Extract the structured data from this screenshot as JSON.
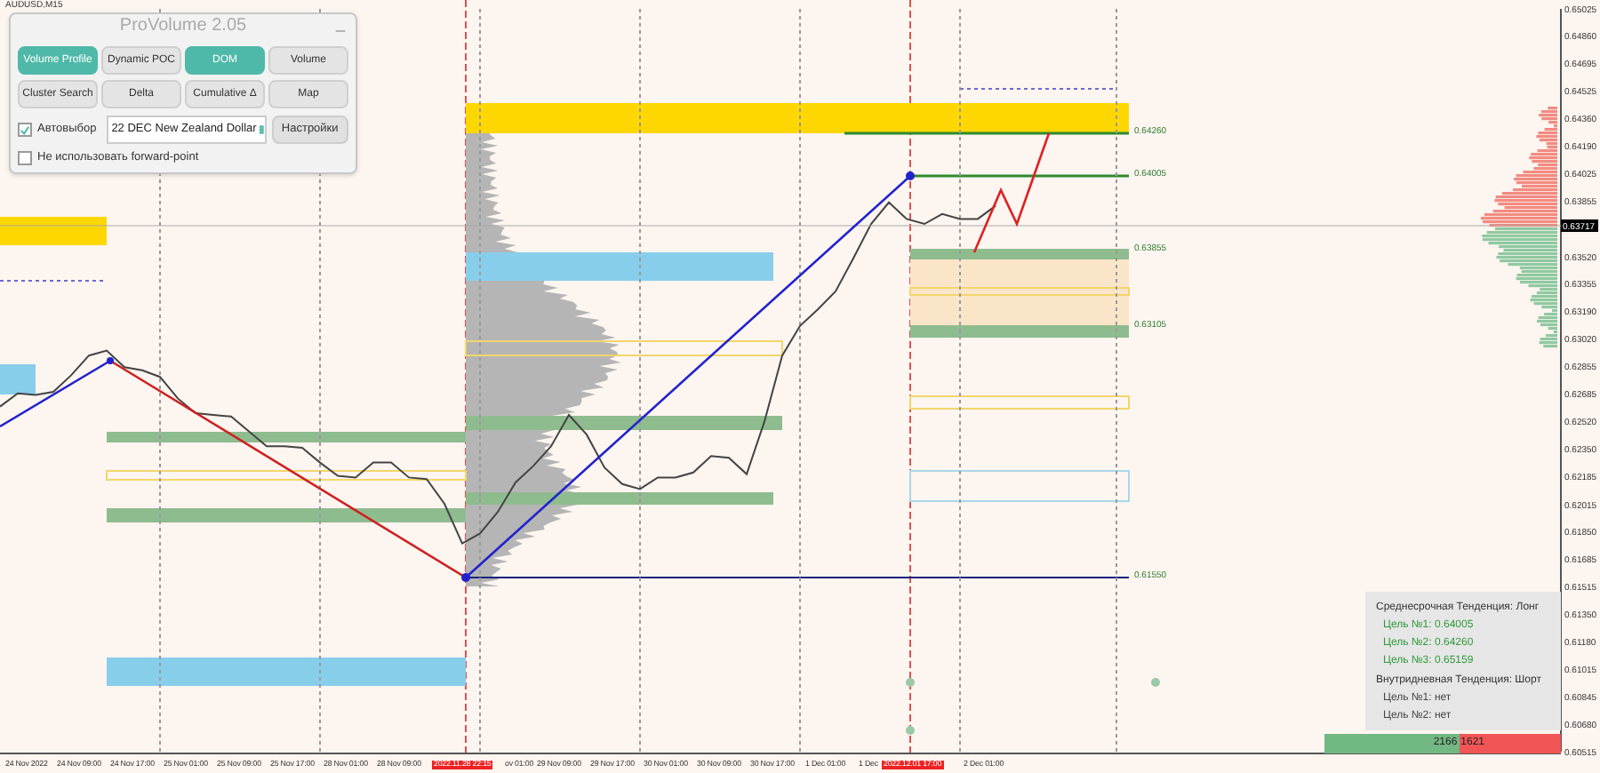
{
  "chart_title": "AUDUSD,M15",
  "panel": {
    "title": "ProVolume 2.05",
    "minimize": "_",
    "buttons": [
      {
        "label": "Volume Profile",
        "selected": true
      },
      {
        "label": "Dynamic POC",
        "selected": false
      },
      {
        "label": "DOM",
        "selected": true
      },
      {
        "label": "Volume",
        "selected": false
      },
      {
        "label": "Cluster Search",
        "selected": false
      },
      {
        "label": "Delta",
        "selected": false
      },
      {
        "label": "Cumulative Δ",
        "selected": false
      },
      {
        "label": "Map",
        "selected": false
      }
    ],
    "auto_select": {
      "label": "Автовыбор",
      "checked": true
    },
    "instrument": {
      "value": "22 DEC New Zealand Dollar"
    },
    "settings_button": "Настройки",
    "forward_point": {
      "label": "Не использовать forward-point",
      "checked": false
    }
  },
  "chart_data": {
    "type": "line",
    "grid": true,
    "ylim": [
      0.60515,
      0.65025
    ],
    "yticks": [
      {
        "value": 0.65025,
        "label": "0.65025"
      },
      {
        "value": 0.6486,
        "label": "0.64860"
      },
      {
        "value": 0.64695,
        "label": "0.64695"
      },
      {
        "value": 0.64525,
        "label": "0.64525"
      },
      {
        "value": 0.6436,
        "label": "0.64360"
      },
      {
        "value": 0.6419,
        "label": "0.64190"
      },
      {
        "value": 0.64025,
        "label": "0.64025"
      },
      {
        "value": 0.63855,
        "label": "0.63855"
      },
      {
        "value": 0.6352,
        "label": "0.63520"
      },
      {
        "value": 0.63355,
        "label": "0.63355"
      },
      {
        "value": 0.6319,
        "label": "0.63190"
      },
      {
        "value": 0.6302,
        "label": "0.63020"
      },
      {
        "value": 0.62855,
        "label": "0.62855"
      },
      {
        "value": 0.62685,
        "label": "0.62685"
      },
      {
        "value": 0.6252,
        "label": "0.62520"
      },
      {
        "value": 0.6235,
        "label": "0.62350"
      },
      {
        "value": 0.62185,
        "label": "0.62185"
      },
      {
        "value": 0.62015,
        "label": "0.62015"
      },
      {
        "value": 0.6185,
        "label": "0.61850"
      },
      {
        "value": 0.61685,
        "label": "0.61685"
      },
      {
        "value": 0.61515,
        "label": "0.61515"
      },
      {
        "value": 0.6135,
        "label": "0.61350"
      },
      {
        "value": 0.6118,
        "label": "0.61180"
      },
      {
        "value": 0.61015,
        "label": "0.61015"
      },
      {
        "value": 0.60845,
        "label": "0.60845"
      },
      {
        "value": 0.6068,
        "label": "0.60680"
      },
      {
        "value": 0.60515,
        "label": "0.60515"
      }
    ],
    "series": [
      {
        "color": "#444444",
        "values": [
          0.6261,
          0.6269,
          0.6268,
          0.627,
          0.628,
          0.6292,
          0.6295,
          0.6285,
          0.6283,
          0.6279,
          0.6266,
          0.6257,
          0.6256,
          0.6255,
          0.6246,
          0.6237,
          0.6237,
          0.6236,
          0.6227,
          0.6219,
          0.6218,
          0.6227,
          0.6227,
          0.6218,
          0.6217,
          0.6202,
          0.6178,
          0.6184,
          0.6197,
          0.6215,
          0.6225,
          0.6237,
          0.6256,
          0.6244,
          0.6224,
          0.6214,
          0.6211,
          0.6218,
          0.6218,
          0.6221,
          0.6231,
          0.623,
          0.622,
          0.6252,
          0.6292,
          0.631,
          0.632,
          0.6331,
          0.6351,
          0.6372,
          0.6385,
          0.6375,
          0.6372,
          0.6378,
          0.6375,
          0.6375,
          0.6383
        ]
      }
    ]
  },
  "current_price": "0.63717",
  "time_axis": [
    {
      "kind": "time",
      "text": "24 Nov 2022"
    },
    {
      "kind": "time",
      "text": "24 Nov 09:00"
    },
    {
      "kind": "time",
      "text": "24 Nov 17:00"
    },
    {
      "kind": "time",
      "text": "25 Nov 01:00"
    },
    {
      "kind": "time",
      "text": "25 Nov 09:00"
    },
    {
      "kind": "time",
      "text": "25 Nov 17:00"
    },
    {
      "kind": "time",
      "text": "28 Nov 01:00"
    },
    {
      "kind": "time",
      "text": "28 Nov 09:00"
    },
    {
      "kind": "marker",
      "text": "2022.11.28 22:15"
    },
    {
      "kind": "time",
      "text": "ov 01:00"
    },
    {
      "kind": "time",
      "text": "29 Nov 09:00"
    },
    {
      "kind": "time",
      "text": "29 Nov 17:00"
    },
    {
      "kind": "time",
      "text": "30 Nov 01:00"
    },
    {
      "kind": "time",
      "text": "30 Nov 09:00"
    },
    {
      "kind": "time",
      "text": "30 Nov 17:00"
    },
    {
      "kind": "time",
      "text": "1 Dec 01:00"
    },
    {
      "kind": "time",
      "text": "1 Dec"
    },
    {
      "kind": "marker",
      "text": "2022.12.01 17:00"
    },
    {
      "kind": "time",
      "text": "2 Dec 01:00"
    }
  ],
  "level_labels": [
    "0.64260",
    "0.64005",
    "0.63855",
    "0.63105",
    "0.61550"
  ],
  "info": {
    "lines": [
      {
        "kind": "heading",
        "text": "Среднесрочная Тенденция: Лонг"
      },
      {
        "kind": "target",
        "text": "Цель №1: 0.64005"
      },
      {
        "kind": "target",
        "text": "Цель №2: 0.64260"
      },
      {
        "kind": "target",
        "text": "Цель №3: 0.65159"
      },
      {
        "kind": "heading",
        "text": "Внутридневная Тенденция: Шорт"
      },
      {
        "kind": "plain",
        "text": "Цель №1: нет"
      },
      {
        "kind": "plain",
        "text": "Цель №2: нет"
      }
    ]
  },
  "volume_bar": {
    "buy": "2166",
    "sell": "1621"
  }
}
